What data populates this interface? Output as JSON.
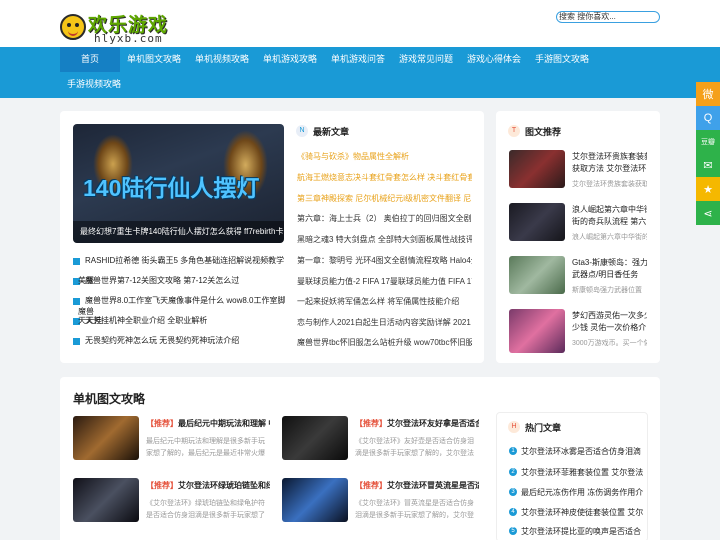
{
  "header": {
    "logo_text": "欢乐游戏",
    "logo_sub": "hlyxb.com",
    "search_text": "搜索 搜你喜欢..."
  },
  "nav": [
    {
      "label": "首页",
      "active": true
    },
    {
      "label": "单机图文攻略"
    },
    {
      "label": "单机视频攻略"
    },
    {
      "label": "单机游戏攻略"
    },
    {
      "label": "单机游戏问答"
    },
    {
      "label": "游戏常见问题"
    },
    {
      "label": "游戏心得体会"
    },
    {
      "label": "手游图文攻略"
    },
    {
      "label": "手游视频攻略"
    }
  ],
  "featured": {
    "big_text": "140陆行仙人摆灯",
    "caption": "最终幻想7重生卡牌140陆行仙人摆灯怎么获得 ff7rebirth卡"
  },
  "left_list": [
    "RASHID拉希德 街头霸王5 多角色基础连招解说视频教学 街",
    "魔兽世界第7-12关图文攻略 第7-12关怎么过",
    "魔兽世界8.0工作室飞天魔像事件是什么 wow8.0工作室脚本",
    "天天挂机神全职业介绍 全职业解析",
    "无畏契约死神怎么玩 无畏契约死神玩法介绍"
  ],
  "left_list_overlay": [
    "美服",
    "魔兽",
    "天天挂"
  ],
  "latest": {
    "title": "最新文章",
    "badge": "N",
    "items": [
      {
        "text": "《骑马与砍杀》物品属性全解析",
        "color": "#e8a21a"
      },
      {
        "text": "航海王燃烧意志决斗套红骨套怎么样 决斗套红骨套...",
        "color": "#e8a21a"
      },
      {
        "text": "第三章神殿探索 尼尔机械纪元i级机密文件翻译 尼...",
        "color": "#e8a21a"
      },
      {
        "text": "第六章：海上士兵（2） 奥伯拉丁的回归图文全剧...",
        "color": "#333"
      },
      {
        "text": "黑暗之魂3 特大剑盘点 全部特大剑面板属性战技评测",
        "color": "#333"
      },
      {
        "text": "第一章：黎明号 光环4图文全剧情流程攻略 Halo4全...",
        "color": "#333"
      },
      {
        "text": "曼联球员能力值-2 FIFA 17曼联球员能力值 FIFA 17...",
        "color": "#333"
      },
      {
        "text": "一起来捉妖将军俑怎么样 将军俑属性技能介绍",
        "color": "#333"
      },
      {
        "text": "恋与制作人2021白起生日活动内容奖励详解 2021白...",
        "color": "#333"
      },
      {
        "text": "魔兽世界tbc怀旧服怎么站桩升级 wow70tbc怀旧服...",
        "color": "#333"
      }
    ]
  },
  "tuwen": {
    "title": "图文推荐",
    "badge": "T",
    "items": [
      {
        "title": "艾尔登法环贵族套装获取方法 艾尔登法环",
        "sub": "艾尔登法环贵族套装获取"
      },
      {
        "title": "浪人崛起第六章中华街的奇兵队流程 第六",
        "sub": "浪人崛起第六章中华街的"
      },
      {
        "title": "Gta3-斯康顿岛：强力武器点/明日香任务",
        "sub": "斯康顿岛强力武器位置"
      },
      {
        "title": "梦幻西游灵佑一次多少钱 灵佑一次价格介",
        "sub": "3000万游戏币。买一个佑"
      }
    ]
  },
  "danji": {
    "title": "单机图文攻略",
    "items": [
      {
        "tag": "【推荐】",
        "title": "最后纪元中期玩法和理解 中",
        "desc": "最后纪元中期玩法和理解是很多新手玩家想了解的，最后纪元是最近非常火爆"
      },
      {
        "tag": "【推荐】",
        "title": "艾尔登法环友好拿是否适合",
        "desc": "《艾尔登法环》友好壶是否适合仿身泪滴是很多新手玩家想了解的，艾尔登法"
      },
      {
        "tag": "【推荐】",
        "title": "艾尔登法环绿琥珀链坠和绿",
        "desc": "《艾尔登法环》绿琥珀链坠和绿龟护符是否适合仿身泪滴是很多新手玩家想了"
      },
      {
        "tag": "【推荐】",
        "title": "艾尔登法环冒英流星是否适",
        "desc": "《艾尔登法环》冒英流星是否适合仿身泪滴是很多新手玩家想了解的，艾尔登"
      }
    ]
  },
  "hot": {
    "title": "热门文章",
    "badge": "H",
    "items": [
      {
        "num": "1",
        "text": "艾尔登法环冰雾是否适合仿身泪滴"
      },
      {
        "num": "2",
        "text": "艾尔登法环菲雅套装位置 艾尔登法"
      },
      {
        "num": "3",
        "text": "最后纪元冻伤作用 冻伤调务作用介"
      },
      {
        "num": "4",
        "text": "艾尔登法环神皮使徒套装位置 艾尔"
      },
      {
        "num": "5",
        "text": "艾尔登法环提比亚的唤声是否适合"
      }
    ]
  },
  "share": [
    {
      "icon": "weibo-icon",
      "glyph": "微",
      "color": "#f5a01a"
    },
    {
      "icon": "qq-icon",
      "glyph": "Q",
      "color": "#3fa1ea"
    },
    {
      "icon": "douban-icon",
      "glyph": "豆瓣",
      "color": "#2eb24a"
    },
    {
      "icon": "wechat-icon",
      "glyph": "✉",
      "color": "#2eb24a"
    },
    {
      "icon": "qzone-icon",
      "glyph": "★",
      "color": "#f5b800"
    },
    {
      "icon": "share-icon",
      "glyph": "⋖",
      "color": "#2eb24a"
    }
  ]
}
